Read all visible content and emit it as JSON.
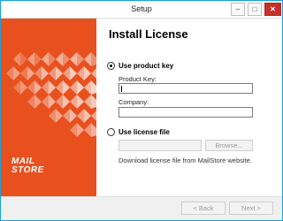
{
  "window": {
    "title": "Setup",
    "controls": {
      "minimize": "–",
      "maximize": "□",
      "close": "✕"
    }
  },
  "sidebar": {
    "brand_color": "#e8501e",
    "logo_line1": "MAIL",
    "logo_line2": "STORE"
  },
  "content": {
    "heading": "Install License",
    "option_product_key": {
      "label": "Use product key",
      "selected": true,
      "product_key_label": "Product Key:",
      "product_key_value": "",
      "company_label": "Company:",
      "company_value": ""
    },
    "option_license_file": {
      "label": "Use license file",
      "selected": false,
      "file_value": "",
      "browse_label": "Browse...",
      "download_text": "Download license file from MailStore website."
    }
  },
  "footer": {
    "back_label": "< Back",
    "next_label": "Next >"
  }
}
